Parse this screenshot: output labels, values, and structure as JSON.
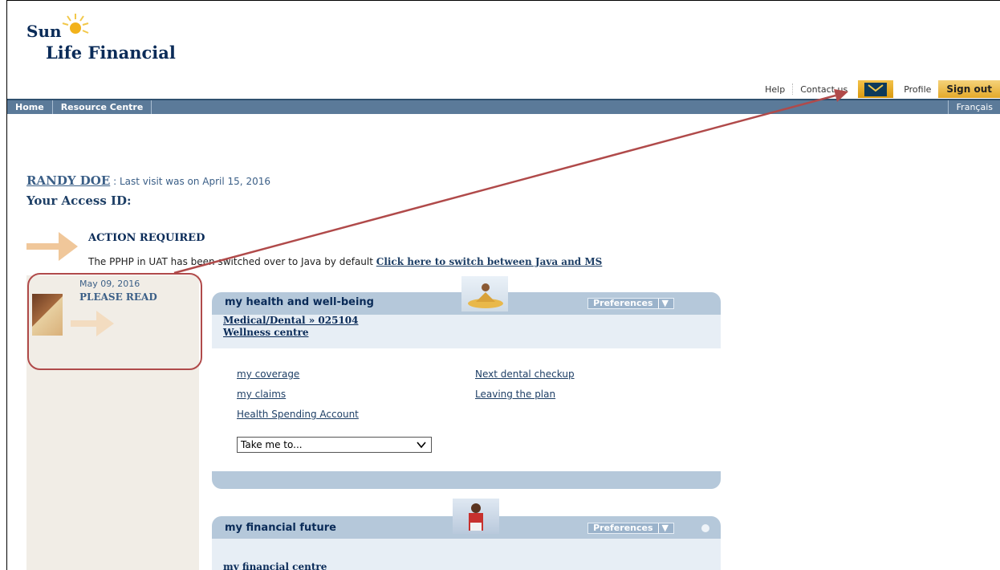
{
  "header": {
    "logo_line1": "Sun",
    "logo_line2": "Life Financial",
    "nav": {
      "help": "Help",
      "contact": "Contact us",
      "profile": "Profile",
      "signout": "Sign out"
    }
  },
  "menubar": {
    "home": "Home",
    "resource": "Resource Centre",
    "language": "Français"
  },
  "user": {
    "name": "RANDY DOE",
    "last_visit": ": Last visit was on April 15, 2016",
    "access_id_label": "Your Access ID:"
  },
  "action": {
    "title": "ACTION REQUIRED",
    "text": "The PPHP in UAT has been switched over to Java by default ",
    "link": "Click here to switch between Java and MS"
  },
  "sidebar": {
    "date": "May 09, 2016",
    "heading": "PLEASE READ"
  },
  "panel1": {
    "title": "my health and well-being",
    "prefs": "Preferences",
    "band_link1": "Medical/Dental » 025104",
    "band_link2": "Wellness centre",
    "links": {
      "coverage": "my coverage",
      "claims": "my claims",
      "hsa": "Health Spending Account",
      "dental": "Next dental checkup",
      "leaving": "Leaving the plan"
    },
    "select_value": "Take me to..."
  },
  "panel2": {
    "title": "my financial future",
    "prefs": "Preferences",
    "band_link1": "my financial centre"
  },
  "colors": {
    "navy": "#0a2b58",
    "menubar": "#5b7a99",
    "panel": "#b5c8da",
    "callout": "#b04a4a",
    "gold": "#e3a92a"
  }
}
